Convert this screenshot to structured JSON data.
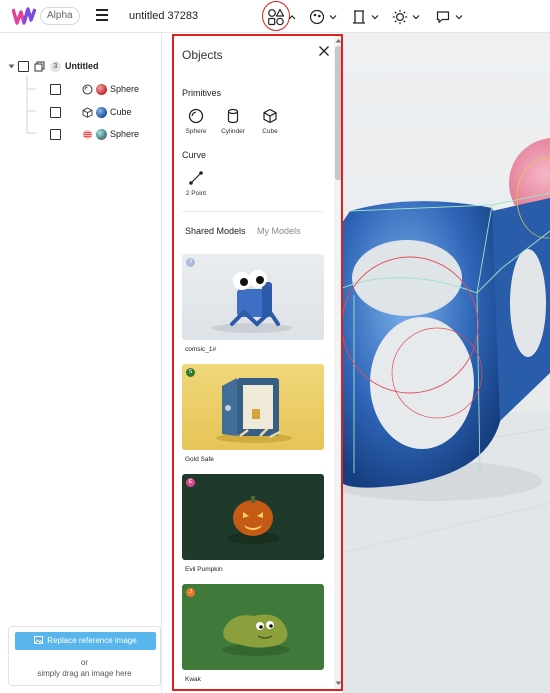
{
  "header": {
    "alpha_badge": "Alpha",
    "doc_title": "untitled 37283"
  },
  "colors": {
    "accent_blue": "#58b6ec",
    "highlight_red": "#e02020",
    "logo_pink": "#e2419a",
    "logo_purple": "#7a4de0"
  },
  "outliner": {
    "root": {
      "count": "3",
      "label": "Untitled"
    },
    "items": [
      {
        "label": "Sphere",
        "type_icon": "sphere-icon",
        "material": "red"
      },
      {
        "label": "Cube",
        "type_icon": "cube-icon",
        "material": "blue"
      },
      {
        "label": "Sphere",
        "type_icon": "sphere-striped-icon",
        "material": "teal"
      }
    ]
  },
  "reference": {
    "button_label": "Replace reference image",
    "or_text": "or",
    "drag_text": "simply drag an image here"
  },
  "objects_panel": {
    "title": "Objects",
    "primitives_heading": "Primitives",
    "primitives": [
      {
        "label": "Sphere",
        "icon": "sphere-icon"
      },
      {
        "label": "Cylinder",
        "icon": "cylinder-icon"
      },
      {
        "label": "Cube",
        "icon": "cube-icon"
      }
    ],
    "curve_heading": "Curve",
    "curves": [
      {
        "label": "2 Point",
        "icon": "curve-icon"
      }
    ],
    "tabs": {
      "shared": "Shared Models",
      "mine": "My Models"
    },
    "models": [
      {
        "name": "comsic_1#",
        "avatar": "3",
        "avatar_color": "#a9b9d8"
      },
      {
        "name": "Gold Safe",
        "avatar": "S",
        "avatar_color": "#2f7a2f"
      },
      {
        "name": "Evil Pumpkin",
        "avatar": "E",
        "avatar_color": "#d94a8c"
      },
      {
        "name": "Kwak",
        "avatar": "J",
        "avatar_color": "#e8772a"
      }
    ]
  }
}
